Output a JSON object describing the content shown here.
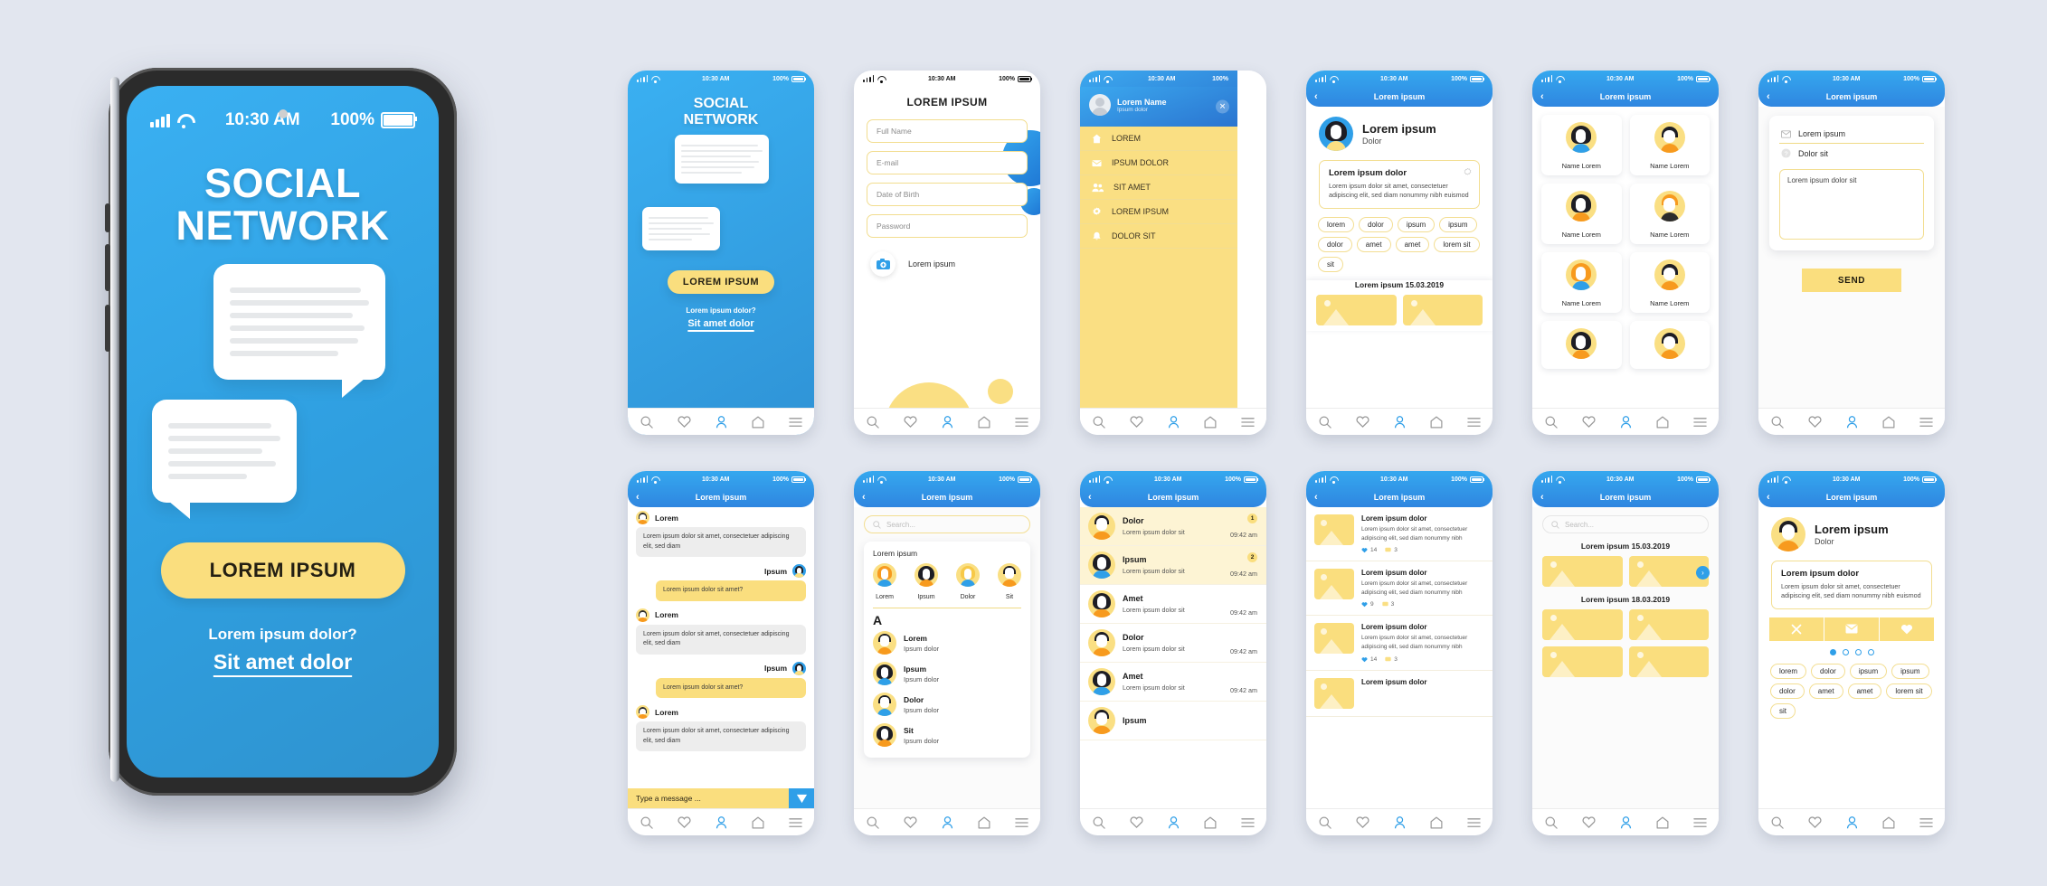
{
  "status_bar": {
    "time": "10:30 AM",
    "battery": "100%"
  },
  "big_phone": {
    "title_line1": "SOCIAL",
    "title_line2": "NETWORK",
    "cta_label": "LOREM IPSUM",
    "sub_question": "Lorem ipsum dolor?",
    "sub_link": "Sit amet dolor"
  },
  "screens": {
    "onboarding": {
      "title_line1": "SOCIAL",
      "title_line2": "NETWORK",
      "cta_label": "LOREM IPSUM",
      "sub_question": "Lorem ipsum dolor?",
      "sub_link": "Sit amet dolor"
    },
    "signup": {
      "title": "LOREM IPSUM",
      "fields": [
        "Full Name",
        "E-mail",
        "Date of Birth",
        "Password"
      ],
      "upload_label": "Lorem ipsum"
    },
    "menu": {
      "user_name": "Lorem Name",
      "user_sub": "Ipsum dolor",
      "close_label": "✕",
      "items": [
        {
          "label": "LOREM",
          "icon": "home-icon"
        },
        {
          "label": "IPSUM DOLOR",
          "icon": "mail-icon"
        },
        {
          "label": "SIT AMET",
          "icon": "people-icon"
        },
        {
          "label": "LOREM IPSUM",
          "icon": "gear-icon"
        },
        {
          "label": "DOLOR SIT",
          "icon": "bell-icon"
        }
      ]
    },
    "profile": {
      "nav_title": "Lorem ipsum",
      "name": "Lorem ipsum",
      "role": "Dolor",
      "post_title": "Lorem ipsum dolor",
      "post_body": "Lorem ipsum dolor sit amet, consectetuer adipiscing elit, sed diam nonummy nibh euismod",
      "tags": [
        "lorem",
        "dolor",
        "ipsum",
        "ipsum",
        "dolor",
        "amet",
        "amet",
        "lorem sit",
        "sit"
      ],
      "gallery_date": "Lorem ipsum 15.03.2019"
    },
    "contacts_grid": {
      "nav_title": "Lorem ipsum",
      "cards": [
        {
          "name": "Name Lorem"
        },
        {
          "name": "Name Lorem"
        },
        {
          "name": "Name Lorem"
        },
        {
          "name": "Name Lorem"
        },
        {
          "name": "Name Lorem"
        },
        {
          "name": "Name Lorem"
        },
        {
          "name": ""
        },
        {
          "name": ""
        }
      ]
    },
    "compose": {
      "nav_title": "Lorem ipsum",
      "field1": "Lorem ipsum",
      "field2": "Dolor sit",
      "textarea": "Lorem ipsum dolor sit",
      "send_label": "SEND"
    },
    "chat": {
      "nav_title": "Lorem ipsum",
      "messages": [
        {
          "side": "left",
          "author": "Lorem",
          "text": "Lorem ipsum dolor sit amet, consectetuer adipiscing elit, sed diam"
        },
        {
          "side": "right",
          "author": "Ipsum",
          "text": "Lorem ipsum dolor sit amet?"
        },
        {
          "side": "left",
          "author": "Lorem",
          "text": "Lorem ipsum dolor sit amet, consectetuer adipiscing elit, sed diam"
        },
        {
          "side": "right",
          "author": "Ipsum",
          "text": "Lorem ipsum dolor sit amet?"
        },
        {
          "side": "left",
          "author": "Lorem",
          "text": "Lorem ipsum dolor sit amet, consectetuer adipiscing elit, sed diam"
        }
      ],
      "composer_placeholder": "Type a message ..."
    },
    "contacts_list": {
      "nav_title": "Lorem ipsum",
      "search_placeholder": "Search...",
      "recent_title": "Lorem ipsum",
      "recent": [
        "Lorem",
        "Ipsum",
        "Dolor",
        "Sit"
      ],
      "section_letter": "A",
      "people": [
        {
          "name": "Lorem",
          "sub": "Ipsum dolor"
        },
        {
          "name": "Ipsum",
          "sub": "Ipsum dolor"
        },
        {
          "name": "Dolor",
          "sub": "Ipsum dolor"
        },
        {
          "name": "Sit",
          "sub": "Ipsum dolor"
        }
      ]
    },
    "message_list": {
      "nav_title": "Lorem ipsum",
      "rows": [
        {
          "name": "Dolor",
          "preview": "Lorem ipsum dolor sit",
          "time": "09:42 am",
          "badge": "1",
          "unread": true
        },
        {
          "name": "Ipsum",
          "preview": "Lorem ipsum dolor sit",
          "time": "09:42 am",
          "badge": "2",
          "unread": true
        },
        {
          "name": "Amet",
          "preview": "Lorem ipsum dolor sit",
          "time": "09:42 am",
          "badge": "",
          "unread": false
        },
        {
          "name": "Dolor",
          "preview": "Lorem ipsum dolor sit",
          "time": "09:42 am",
          "badge": "",
          "unread": false
        },
        {
          "name": "Amet",
          "preview": "Lorem ipsum dolor sit",
          "time": "09:42 am",
          "badge": "",
          "unread": false
        },
        {
          "name": "Ipsum",
          "preview": "",
          "time": "",
          "badge": "",
          "unread": false
        }
      ]
    },
    "feed": {
      "nav_title": "Lorem ipsum",
      "posts": [
        {
          "title": "Lorem ipsum dolor",
          "body": "Lorem ipsum dolor sit amet, consectetuer adipiscing elit, sed diam nonummy nibh",
          "likes": "14",
          "comments": "3"
        },
        {
          "title": "Lorem ipsum dolor",
          "body": "Lorem ipsum dolor sit amet, consectetuer adipiscing elit, sed diam nonummy nibh",
          "likes": "9",
          "comments": "3"
        },
        {
          "title": "Lorem ipsum dolor",
          "body": "Lorem ipsum dolor sit amet, consectetuer adipiscing elit, sed diam nonummy nibh",
          "likes": "14",
          "comments": "3"
        },
        {
          "title": "Lorem ipsum dolor",
          "body": "",
          "likes": "",
          "comments": ""
        }
      ]
    },
    "gallery": {
      "nav_title": "Lorem ipsum",
      "search_placeholder": "Search...",
      "date1": "Lorem ipsum 15.03.2019",
      "date2": "Lorem ipsum 18.03.2019"
    },
    "profile_actions": {
      "nav_title": "Lorem ipsum",
      "name": "Lorem ipsum",
      "role": "Dolor",
      "post_title": "Lorem ipsum dolor",
      "post_body": "Lorem ipsum dolor sit amet, consectetuer adipiscing elit, sed diam nonummy nibh euismod",
      "actions": [
        "close-icon",
        "mail-icon",
        "heart-icon"
      ],
      "dots": 4,
      "active_dot": 1,
      "tags": [
        "lorem",
        "dolor",
        "ipsum",
        "ipsum",
        "dolor",
        "amet",
        "amet",
        "lorem sit",
        "sit"
      ]
    }
  },
  "tabbar": {
    "items": [
      "search-icon",
      "heart-icon",
      "person-icon",
      "home-icon",
      "menu-icon"
    ]
  },
  "colors": {
    "blue": "#2f9fe8",
    "blue_dark": "#2f86e0",
    "yellow": "#fade7e",
    "bg": "#e2e6ef"
  }
}
